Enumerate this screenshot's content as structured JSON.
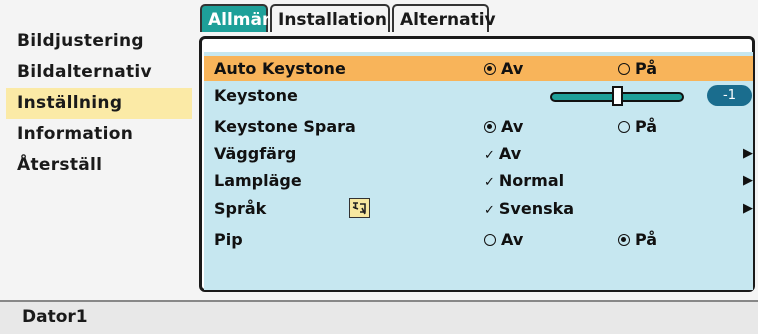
{
  "sidebar": {
    "items": [
      {
        "label": "Bildjustering",
        "selected": false
      },
      {
        "label": "Bildalternativ",
        "selected": false
      },
      {
        "label": "Inställning",
        "selected": true
      },
      {
        "label": "Information",
        "selected": false
      },
      {
        "label": "Återställ",
        "selected": false
      }
    ]
  },
  "tabs": [
    {
      "label": "Allmän",
      "active": true
    },
    {
      "label": "Installation",
      "active": false
    },
    {
      "label": "Alternativ",
      "active": false
    }
  ],
  "settings": {
    "auto_keystone": {
      "label": "Auto Keystone",
      "opt1": "Av",
      "opt2": "På",
      "selected": "Av"
    },
    "keystone": {
      "label": "Keystone",
      "value": "-1"
    },
    "keystone_spara": {
      "label": "Keystone Spara",
      "opt1": "Av",
      "opt2": "På",
      "selected": "Av"
    },
    "vaggfarg": {
      "label": "Väggfärg",
      "value": "Av"
    },
    "lamplage": {
      "label": "Lampläge",
      "value": "Normal"
    },
    "sprak": {
      "label": "Språk",
      "value": "Svenska"
    },
    "pip": {
      "label": "Pip",
      "opt1": "Av",
      "opt2": "På",
      "selected": "På"
    }
  },
  "status": {
    "source": "Dator1"
  },
  "colors": {
    "accent": "#1ea099",
    "highlight": "#f8b45a",
    "panel_bg": "#c6e7f0",
    "sidebar_selected": "#fbeaa6",
    "value_pill": "#1a6d8e"
  }
}
